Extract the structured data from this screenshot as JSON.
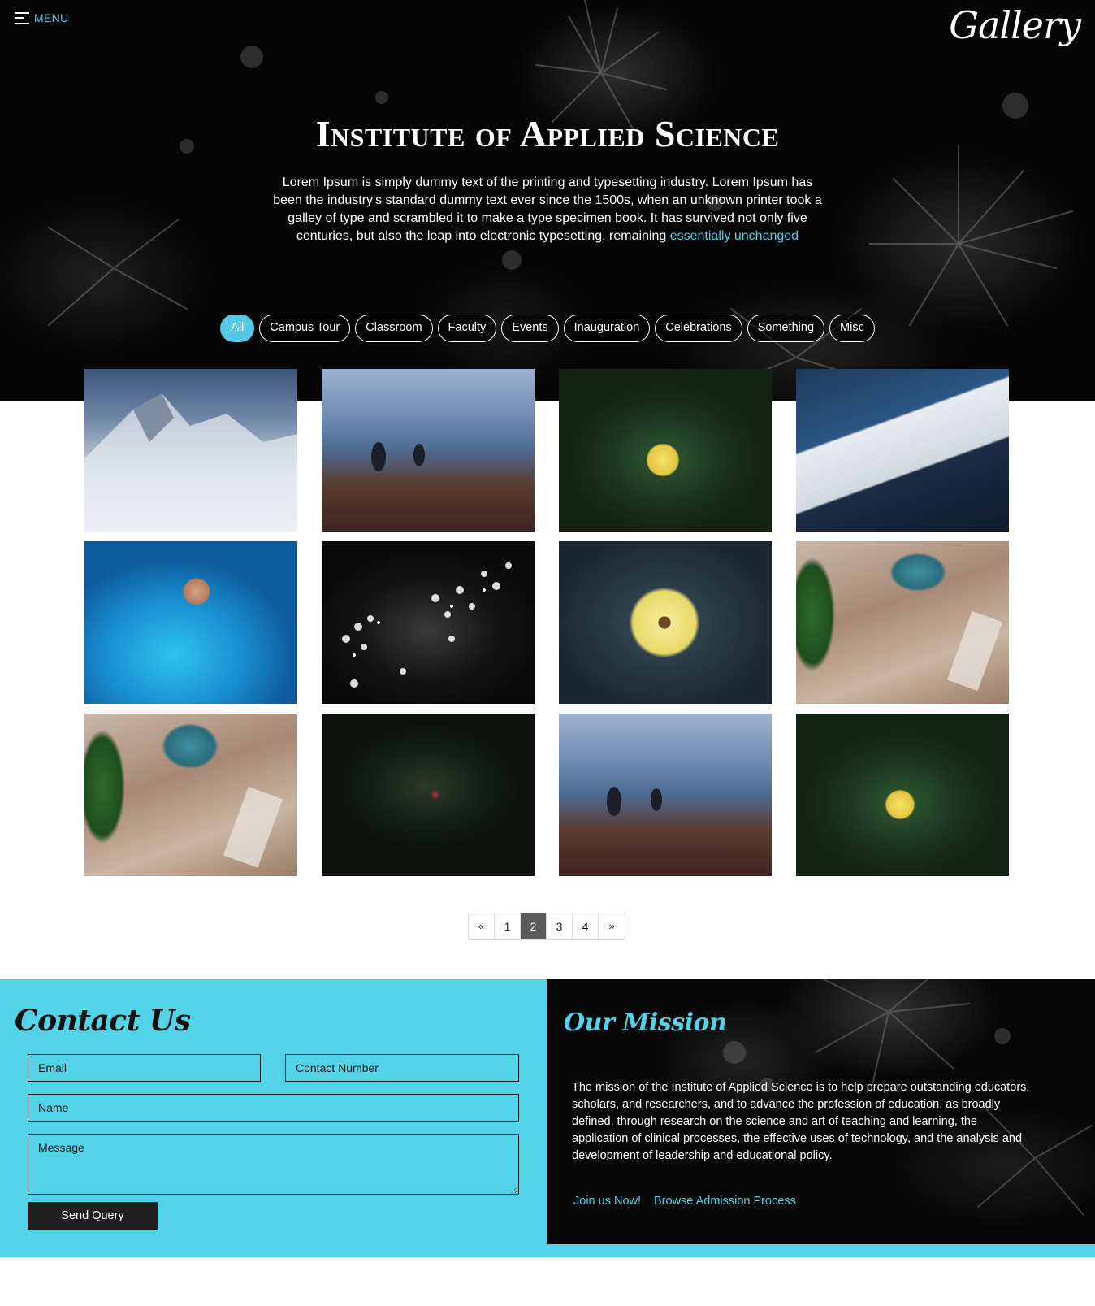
{
  "nav": {
    "menu_label": "MENU",
    "logo_text": "Gallery"
  },
  "hero": {
    "title": "Institute of Applied Science",
    "description": "Lorem Ipsum is simply dummy text of the printing and typesetting industry. Lorem Ipsum has been the industry's standard dummy text ever since the 1500s, when an unknown printer took a galley of type and scrambled it to make a type specimen book. It has survived not only five centuries, but also the leap into electronic typesetting, remaining",
    "description_highlight": "essentially unchanged"
  },
  "filters": {
    "items": [
      "All",
      "Campus Tour",
      "Classroom",
      "Faculty",
      "Events",
      "Inauguration",
      "Celebrations",
      "Something",
      "Misc"
    ],
    "active": "All"
  },
  "gallery": {
    "images": [
      "snowy-mountain-photo",
      "foggy-field-figures-photo",
      "yellow-rose-photo",
      "notebook-writing-photo",
      "blue-smoke-portrait-photo",
      "white-blossoms-photo",
      "yellow-dahlia-photo",
      "typewriter-desk-photo",
      "typewriter-desk-photo-2",
      "dark-foliage-photo",
      "foggy-field-figures-photo-2",
      "yellow-rose-photo-2"
    ]
  },
  "pagination": {
    "prev": "«",
    "next": "»",
    "pages": [
      "1",
      "2",
      "3",
      "4"
    ],
    "current": "2"
  },
  "contact": {
    "title": "Contact Us",
    "email_placeholder": "Email",
    "phone_placeholder": "Contact Number",
    "name_placeholder": "Name",
    "message_placeholder": "Message",
    "submit_label": "Send Query"
  },
  "mission": {
    "title": "Our Mission",
    "text": "The mission of the Institute of Applied Science is to help prepare outstanding educators, scholars, and researchers, and to advance the profession of education, as broadly defined, through research on the science and art of teaching and learning, the application of clinical processes, the effective uses of technology, and the analysis and development of leadership and educational policy.",
    "link_join": "Join us Now!",
    "link_admission": "Browse Admission Process"
  },
  "colors": {
    "accent": "#52d3e8",
    "dark": "#060606",
    "button": "#1f1f1f"
  }
}
